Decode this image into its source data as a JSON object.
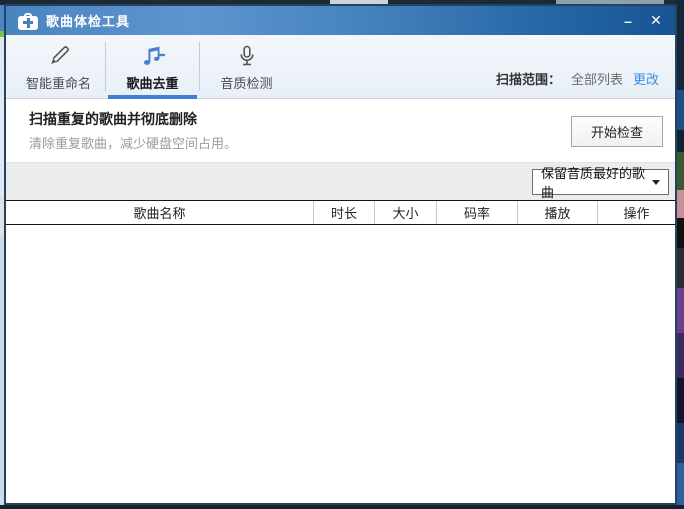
{
  "window": {
    "title": "歌曲体检工具",
    "controls": {
      "minimize_glyph": "–",
      "close_glyph": "✕"
    }
  },
  "tabs": [
    {
      "label": "智能重命名",
      "icon": "pencil-icon",
      "active": false
    },
    {
      "label": "歌曲去重",
      "icon": "music-note-icon",
      "active": true
    },
    {
      "label": "音质检测",
      "icon": "microphone-icon",
      "active": false
    }
  ],
  "scan_range": {
    "label": "扫描范围：",
    "value": "全部列表",
    "change_label": "更改"
  },
  "section": {
    "title": "扫描重复的歌曲并彻底删除",
    "subtitle": "清除重复歌曲，减少硬盘空间占用。",
    "start_button_label": "开始检查"
  },
  "toolbar": {
    "keep_dropdown_value": "保留音质最好的歌曲",
    "dropdown_arrow": "caret-down-icon"
  },
  "table": {
    "columns": [
      "歌曲名称",
      "时长",
      "大小",
      "码率",
      "播放",
      "操作"
    ],
    "rows": []
  },
  "icons": [
    "first-aid-kit-icon",
    "pencil-icon",
    "music-note-icon",
    "microphone-icon",
    "minimize-icon",
    "close-icon",
    "caret-down-icon"
  ],
  "colors": {
    "titlebar_blue": "#4381bd",
    "active_tab_underline": "#3e7fd9",
    "link_blue": "#3a8ee6",
    "note_icon_blue": "#4a7fd0",
    "toolband_gray": "#ececec"
  }
}
